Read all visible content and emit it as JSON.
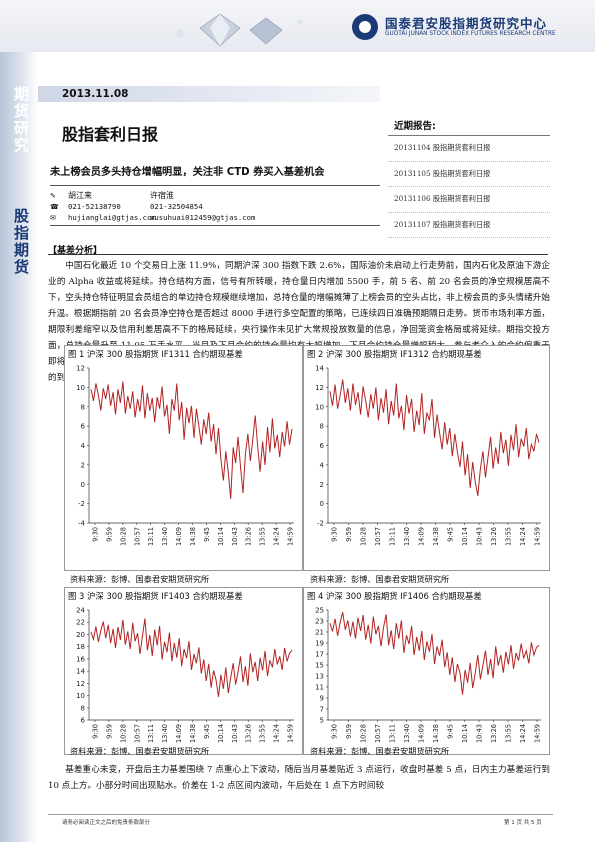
{
  "header": {
    "company_cn": "国泰君安股指期货研究中心",
    "company_en": "GUOTAI JUNAN STOCK INDEX FUTURES RESEARCH CENTRE"
  },
  "sidebar": {
    "label_top": "期货研究",
    "label_bottom": "股指期货"
  },
  "report": {
    "date": "2013.11.08",
    "title": "股指套利日报",
    "subtitle": "未上榜会员多头持仓增幅明显，关注非 CTD 券买入基差机会"
  },
  "contacts": [
    {
      "icon": "person-icon",
      "left": "胡江来",
      "right": "许宿淮"
    },
    {
      "icon": "phone-icon",
      "left": "021-52138790",
      "right": "021-32504854"
    },
    {
      "icon": "email-icon",
      "left": "hujianglai@gtjas.com",
      "right": "xusuhuai012459@gtjas.com"
    }
  ],
  "recent_reports": {
    "title": "近期报告:",
    "items": [
      "20131104 股指期货套利日报",
      "20131105 股指期货套利日报",
      "20131106 股指期货套利日报",
      "20131107 股指期货套利日报"
    ]
  },
  "analysis": {
    "heading": "【基差分析】",
    "text": "中国石化最近 10 个交易日上涨 11.9%，同期沪深 300 指数下跌 2.6%，国际油价未启动上行走势前，国内石化及原油下游企业的 Alpha 收益或将延续。持仓结构方面，信号有所转暖，持仓量日内增加 5500 手，前 5 名、前 20 名会员的净空规模居高不下，空头持仓特征明显会员组合的单边持仓规模继续增加，总持仓量的增幅摊薄了上榜会员的空头占比，非上榜会员的多头情绪升始升温。根据期指前 20 名会员净空持仓是否超过 8000 手进行多空配置的策略，已连续四日准确预期隔日走势。货币市场利率方面，期限利差缩窄以及信用利差居高不下的格局延续，央行操作未见扩大常规投放数量的信息，净回笼资金格局或将延续。期指交投方面，总持仓量升至 11.05 万手水平，当月及下月合约的持仓量均有大幅增加，下月合约持仓量增幅稍大，参与者介入的合约偏重于即将成为新主力合约的 IF1312。预期未来，量化宽松退出时间、央行操作以及政策红利等因素对期指的影响不容忽视。7 年期国债的到期收益率均价已触及 4.29%高位，期指利空格局或延续。",
    "bottom_text": "基差重心未变，开盘后主力基差围绕 7 点重心上下波动，随后当月基差贴近 3 点运行，收盘时基差 5 点，日内主力基差运行到 10 点上方。小部分时间出现贴水。价差在 1-2 点区间内波动，午后处在 1 点下方时间较"
  },
  "source_text": "资料来源：彭博、国泰君安期货研究所",
  "chart_data": [
    {
      "type": "line",
      "title": "图 1 沪深 300 股指期货 IF1311 合约期现基差",
      "categories": [
        "9:30",
        "9:59",
        "10:28",
        "10:57",
        "13:11",
        "13:40",
        "14:09",
        "14:38",
        "9:45",
        "10:14",
        "10:43",
        "13:26",
        "13:55",
        "14:24",
        "14:59"
      ],
      "ylim": [
        -4,
        12
      ],
      "yticks": [
        -4,
        -2,
        0,
        2,
        4,
        6,
        8,
        10,
        12
      ],
      "color": "#b22222",
      "values": [
        9.8,
        8.6,
        10.4,
        9.2,
        7.6,
        9.9,
        8.8,
        10.3,
        8.1,
        9.5,
        7.2,
        9.8,
        8.4,
        10.6,
        7.3,
        9.1,
        7.8,
        9.6,
        6.9,
        8.8,
        7.5,
        10.2,
        6.8,
        9.4,
        7.6,
        8.9,
        6.4,
        9.0,
        7.8,
        10.1,
        7.0,
        8.2,
        5.2,
        8.8,
        7.6,
        10.4,
        6.6,
        8.5,
        4.6,
        7.9,
        6.3,
        8.1,
        4.8,
        7.8,
        6.0,
        4.1,
        6.7,
        5.2,
        7.4,
        4.4,
        6.2,
        3.1,
        5.8,
        2.6,
        0.4,
        3.4,
        1.2,
        -1.5,
        3.8,
        2.2,
        4.9,
        1.8,
        -0.9,
        3.1,
        5.2,
        2.4,
        4.6,
        7.1,
        3.9,
        1.3,
        4.4,
        2.0,
        5.9,
        3.3,
        6.8,
        3.7,
        5.1,
        2.8,
        5.4,
        3.9,
        6.5,
        4.1,
        5.7
      ]
    },
    {
      "type": "line",
      "title": "图 2 沪深 300 股指期货 IF1312 合约期现基差",
      "categories": [
        "9:30",
        "9:59",
        "10:28",
        "10:57",
        "13:11",
        "13:40",
        "14:09",
        "14:38",
        "9:45",
        "10:14",
        "10:43",
        "13:26",
        "13:55",
        "14:24",
        "14:59"
      ],
      "ylim": [
        -2,
        14
      ],
      "yticks": [
        -2,
        0,
        2,
        4,
        6,
        8,
        10,
        12,
        14
      ],
      "color": "#b22222",
      "values": [
        11.6,
        10.1,
        12.3,
        9.8,
        11.2,
        12.8,
        10.4,
        11.9,
        9.6,
        12.4,
        10.2,
        11.5,
        9.2,
        12.1,
        10.6,
        8.9,
        11.3,
        9.8,
        12.0,
        8.6,
        10.9,
        9.4,
        11.8,
        8.2,
        10.6,
        9.1,
        12.4,
        8.8,
        10.1,
        7.6,
        11.2,
        9.3,
        10.8,
        7.4,
        9.6,
        8.1,
        11.4,
        7.2,
        9.4,
        8.6,
        10.8,
        6.8,
        9.2,
        7.3,
        5.6,
        8.4,
        6.1,
        7.8,
        4.9,
        7.2,
        5.3,
        3.8,
        6.4,
        2.9,
        5.1,
        1.6,
        4.3,
        2.2,
        0.8,
        3.6,
        5.4,
        2.7,
        4.8,
        6.9,
        3.6,
        5.8,
        4.1,
        7.4,
        5.2,
        6.6,
        3.9,
        7.1,
        5.5,
        8.2,
        4.8,
        6.7,
        5.9,
        7.8,
        4.6,
        6.1,
        5.4,
        7.2,
        6.3
      ]
    },
    {
      "type": "line",
      "title": "图 3 沪深 300 股指期货 IF1403 合约期现基差",
      "categories": [
        "9:30",
        "9:59",
        "10:28",
        "10:57",
        "13:11",
        "13:40",
        "14:09",
        "14:38",
        "9:45",
        "10:14",
        "10:43",
        "13:26",
        "13:55",
        "14:24",
        "14:59"
      ],
      "ylim": [
        6,
        24
      ],
      "yticks": [
        6,
        8,
        10,
        12,
        14,
        16,
        18,
        20,
        22,
        24
      ],
      "color": "#b22222",
      "values": [
        20.4,
        19.2,
        21.3,
        18.8,
        20.6,
        22.1,
        19.4,
        21.6,
        18.6,
        20.9,
        17.8,
        21.2,
        19.1,
        22.4,
        18.3,
        20.5,
        17.6,
        21.9,
        18.9,
        20.2,
        16.8,
        19.8,
        22.6,
        17.4,
        19.9,
        16.5,
        20.8,
        18.2,
        21.4,
        15.9,
        18.8,
        17.1,
        20.3,
        15.6,
        18.6,
        16.2,
        19.4,
        14.8,
        17.6,
        16.1,
        18.9,
        14.2,
        16.8,
        15.3,
        17.9,
        13.6,
        15.9,
        12.4,
        15.2,
        11.3,
        14.1,
        12.6,
        9.8,
        13.4,
        11.1,
        14.6,
        10.4,
        12.9,
        15.3,
        11.8,
        13.9,
        16.4,
        12.2,
        14.8,
        11.6,
        16.9,
        13.8,
        15.5,
        12.4,
        16.2,
        14.1,
        17.3,
        13.2,
        15.8,
        14.6,
        17.6,
        15.1,
        16.4,
        14.2,
        17.8,
        15.6,
        16.9,
        17.4
      ]
    },
    {
      "type": "line",
      "title": "图 4 沪深 300 股指期货 IF1406 合约期现基差",
      "categories": [
        "9:30",
        "9:59",
        "10:28",
        "10:57",
        "13:11",
        "13:40",
        "14:09",
        "14:38",
        "9:45",
        "10:14",
        "10:43",
        "13:26",
        "13:55",
        "14:24",
        "14:59"
      ],
      "ylim": [
        5,
        25
      ],
      "yticks": [
        5,
        7,
        9,
        11,
        13,
        15,
        17,
        19,
        21,
        23,
        25
      ],
      "color": "#b22222",
      "values": [
        22.6,
        21.1,
        23.4,
        20.3,
        22.8,
        24.6,
        21.4,
        23.1,
        20.2,
        22.9,
        19.8,
        23.6,
        21.2,
        24.1,
        19.6,
        22.3,
        18.9,
        23.8,
        20.6,
        22.1,
        18.4,
        21.8,
        24.2,
        18.6,
        21.3,
        17.9,
        22.6,
        19.8,
        23.1,
        17.2,
        20.4,
        18.8,
        22.1,
        16.8,
        20.1,
        17.6,
        21.2,
        15.9,
        19.3,
        17.4,
        20.6,
        15.2,
        18.4,
        16.7,
        19.6,
        14.6,
        17.3,
        13.2,
        16.4,
        11.9,
        15.2,
        13.6,
        9.6,
        14.1,
        11.8,
        15.4,
        10.8,
        13.6,
        16.8,
        12.4,
        14.9,
        17.6,
        13.2,
        16.1,
        12.6,
        18.4,
        14.9,
        16.8,
        13.6,
        17.4,
        15.1,
        18.6,
        14.3,
        17.2,
        15.8,
        18.9,
        16.2,
        17.6,
        15.3,
        19.1,
        16.8,
        18.2,
        18.6
      ]
    }
  ],
  "footer": {
    "left": "请务必阅读正文之后的免责条款部分",
    "right": "第 1 页 共 5 页"
  }
}
